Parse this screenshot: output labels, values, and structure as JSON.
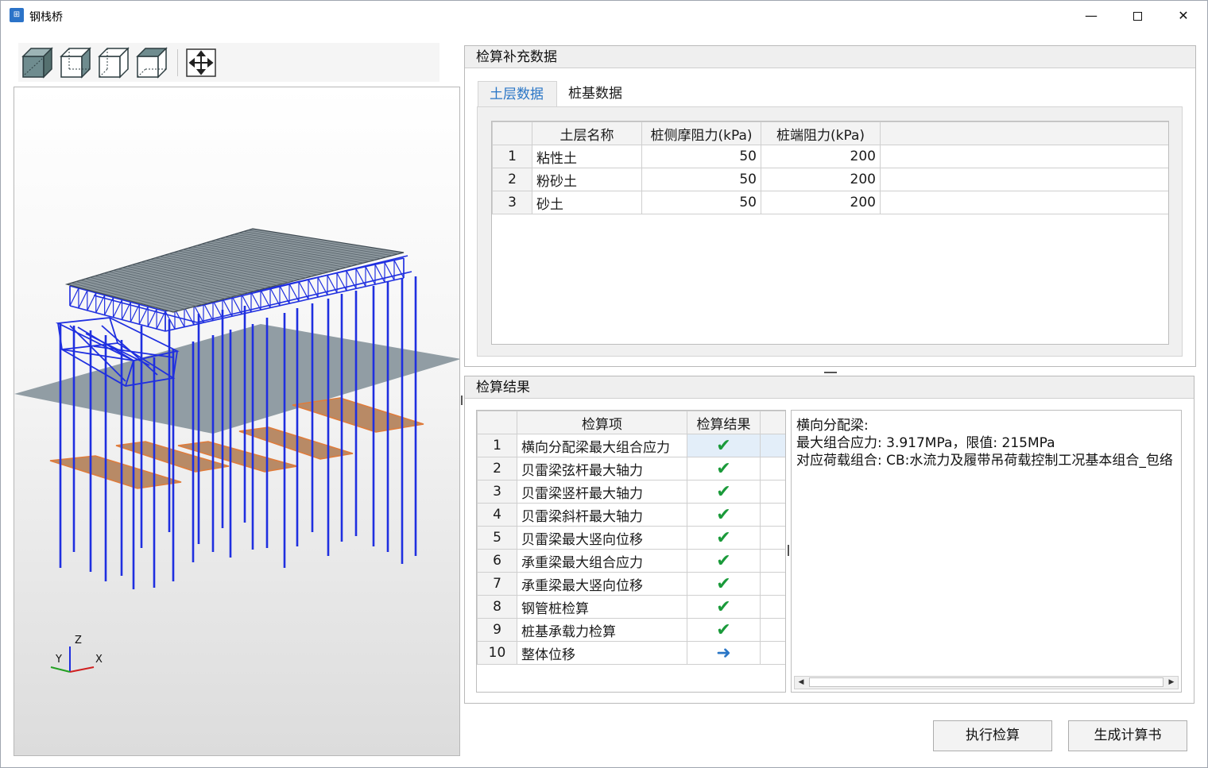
{
  "window": {
    "title": "钢栈桥",
    "app_icon": "bridge-app-icon",
    "controls": [
      "minimize",
      "maximize",
      "close"
    ]
  },
  "toolbar": {
    "buttons": [
      {
        "name": "view-cube-solid-icon"
      },
      {
        "name": "view-cube-front-icon"
      },
      {
        "name": "view-cube-side-icon"
      },
      {
        "name": "view-cube-top-icon"
      },
      {
        "name": "fit-view-icon"
      }
    ]
  },
  "viewport": {
    "axes": {
      "x": "X",
      "y": "Y",
      "z": "Z"
    }
  },
  "supplement": {
    "title": "检算补充数据",
    "tabs": [
      {
        "label": "土层数据",
        "active": true
      },
      {
        "label": "桩基数据",
        "active": false
      }
    ],
    "soil_table": {
      "headers": [
        "土层名称",
        "桩侧摩阻力(kPa)",
        "桩端阻力(kPa)"
      ],
      "rows": [
        {
          "no": "1",
          "name": "粘性土",
          "side": "50",
          "end": "200"
        },
        {
          "no": "2",
          "name": "粉砂土",
          "side": "50",
          "end": "200"
        },
        {
          "no": "3",
          "name": "砂土",
          "side": "50",
          "end": "200"
        }
      ]
    }
  },
  "results": {
    "title": "检算结果",
    "headers": [
      "检算项",
      "检算结果"
    ],
    "rows": [
      {
        "no": "1",
        "item": "横向分配梁最大组合应力",
        "status": "✔",
        "kind": "ok",
        "selected": true
      },
      {
        "no": "2",
        "item": "贝雷梁弦杆最大轴力",
        "status": "✔",
        "kind": "ok"
      },
      {
        "no": "3",
        "item": "贝雷梁竖杆最大轴力",
        "status": "✔",
        "kind": "ok"
      },
      {
        "no": "4",
        "item": "贝雷梁斜杆最大轴力",
        "status": "✔",
        "kind": "ok"
      },
      {
        "no": "5",
        "item": "贝雷梁最大竖向位移",
        "status": "✔",
        "kind": "ok"
      },
      {
        "no": "6",
        "item": "承重梁最大组合应力",
        "status": "✔",
        "kind": "ok"
      },
      {
        "no": "7",
        "item": "承重梁最大竖向位移",
        "status": "✔",
        "kind": "ok"
      },
      {
        "no": "8",
        "item": "钢管桩检算",
        "status": "✔",
        "kind": "ok"
      },
      {
        "no": "9",
        "item": "桩基承载力检算",
        "status": "✔",
        "kind": "ok"
      },
      {
        "no": "10",
        "item": "整体位移",
        "status": "➜",
        "kind": "arrow"
      }
    ],
    "detail": {
      "line1": "横向分配梁:",
      "line2": "最大组合应力: 3.917MPa，限值: 215MPa",
      "line3": "对应荷载组合: CB:水流力及履带吊荷载控制工况基本组合_包络"
    }
  },
  "actions": {
    "run_label": "执行检算",
    "report_label": "生成计算书"
  },
  "colors": {
    "accent": "#2a76c6",
    "ok": "#1a9a3a",
    "structure": "#1f2fe0"
  }
}
